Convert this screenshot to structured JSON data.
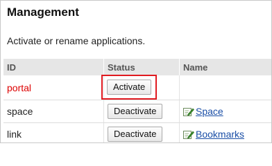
{
  "page": {
    "title": "Management",
    "description": "Activate or rename applications."
  },
  "table": {
    "headers": {
      "id": "ID",
      "status": "Status",
      "name": "Name"
    },
    "rows": [
      {
        "id": "portal",
        "status_button": "Activate",
        "name": "",
        "highlighted": true
      },
      {
        "id": "space",
        "status_button": "Deactivate",
        "name": "Space",
        "icon": "edit-icon"
      },
      {
        "id": "link",
        "status_button": "Deactivate",
        "name": "Bookmarks",
        "icon": "edit-icon"
      }
    ]
  },
  "colors": {
    "inactive_id": "#dd0000",
    "highlight_border": "#e0191f",
    "link": "#1a4ea6",
    "header_bg": "#e6e6e6"
  }
}
